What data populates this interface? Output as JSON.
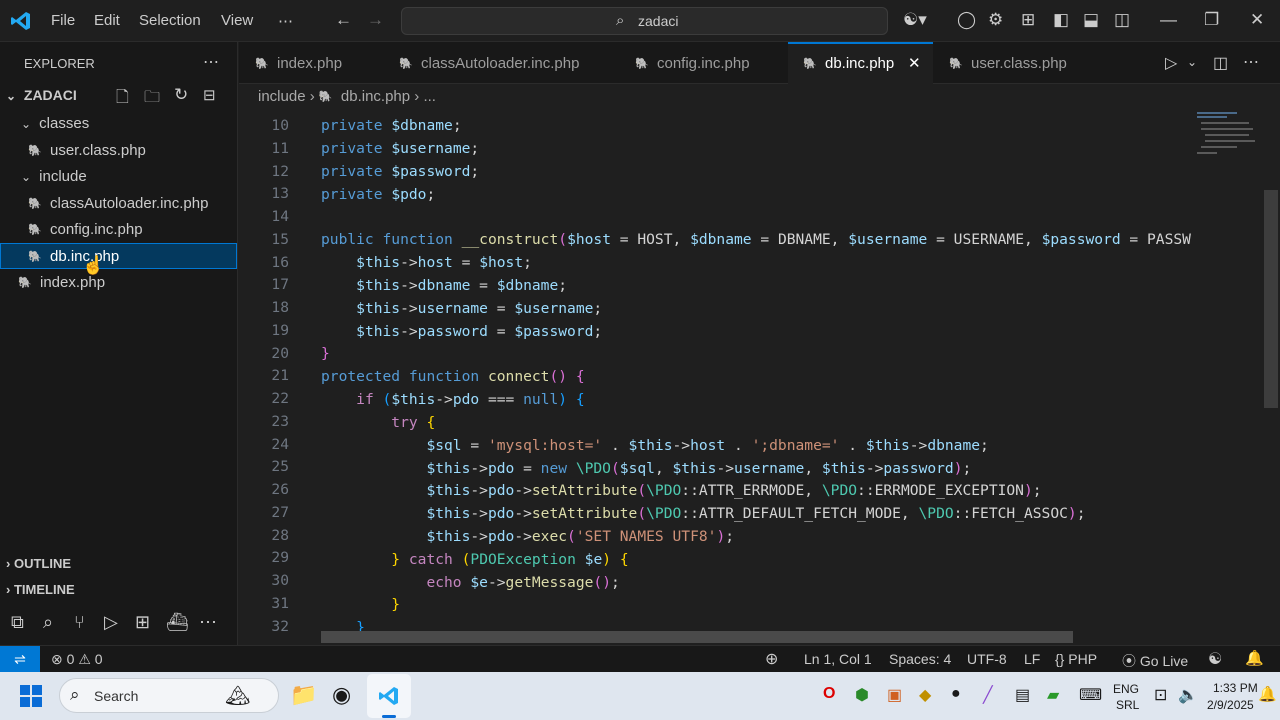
{
  "titlebar": {
    "menus": [
      "File",
      "Edit",
      "Selection",
      "View",
      "⋯"
    ],
    "search_text": "zadaci"
  },
  "sidebar": {
    "header": "EXPLORER",
    "workspace": "ZADACI",
    "tree": [
      {
        "label": "classes",
        "type": "folder"
      },
      {
        "label": "user.class.php",
        "type": "file"
      },
      {
        "label": "include",
        "type": "folder"
      },
      {
        "label": "classAutoloader.inc.php",
        "type": "file"
      },
      {
        "label": "config.inc.php",
        "type": "file"
      },
      {
        "label": "db.inc.php",
        "type": "file",
        "selected": true
      },
      {
        "label": "index.php",
        "type": "file"
      }
    ],
    "sections": [
      "OUTLINE",
      "TIMELINE"
    ]
  },
  "tabs": [
    {
      "label": "index.php"
    },
    {
      "label": "classAutoloader.inc.php"
    },
    {
      "label": "config.inc.php"
    },
    {
      "label": "db.inc.php",
      "active": true
    },
    {
      "label": "user.class.php"
    }
  ],
  "breadcrumb": {
    "folder": "include",
    "file": "db.inc.php",
    "more": "..."
  },
  "editor": {
    "line_numbers": [
      "10",
      "11",
      "12",
      "13",
      "14",
      "15",
      "16",
      "17",
      "18",
      "19",
      "20",
      "21",
      "22",
      "23",
      "24",
      "25",
      "26",
      "27",
      "28",
      "29",
      "30",
      "31",
      "32"
    ]
  },
  "statusbar": {
    "errors": "0",
    "warnings": "0",
    "position": "Ln 1, Col 1",
    "spaces": "Spaces: 4",
    "encoding": "UTF-8",
    "eol": "LF",
    "language": "PHP",
    "golive": "Go Live"
  },
  "taskbar": {
    "search_label": "Search",
    "lang1": "ENG",
    "lang2": "SRL",
    "time": "1:33 PM",
    "date": "2/9/2025"
  },
  "colors": {
    "accent": "#0078d4",
    "php_icon": "#a074c4",
    "selection": "#04395e"
  }
}
